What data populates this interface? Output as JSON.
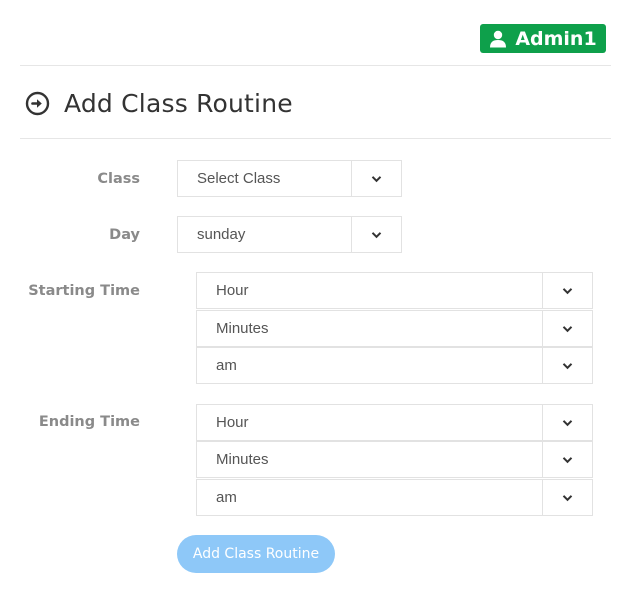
{
  "header": {
    "user_badge": "Admin1"
  },
  "page": {
    "title": "Add Class Routine"
  },
  "form": {
    "class": {
      "label": "Class",
      "value": "Select Class"
    },
    "day": {
      "label": "Day",
      "value": "sunday"
    },
    "starting_time": {
      "label": "Starting Time",
      "hour": "Hour",
      "minutes": "Minutes",
      "meridiem": "am"
    },
    "ending_time": {
      "label": "Ending Time",
      "hour": "Hour",
      "minutes": "Minutes",
      "meridiem": "am"
    },
    "submit_label": "Add Class Routine"
  },
  "icons": {
    "user": "user-icon",
    "title": "circle-arrow-right-icon",
    "dropdown": "chevron-down-icon"
  },
  "colors": {
    "badge": "#0ea04b",
    "submit": "#8ec8f8",
    "label": "#8a8a8a"
  }
}
